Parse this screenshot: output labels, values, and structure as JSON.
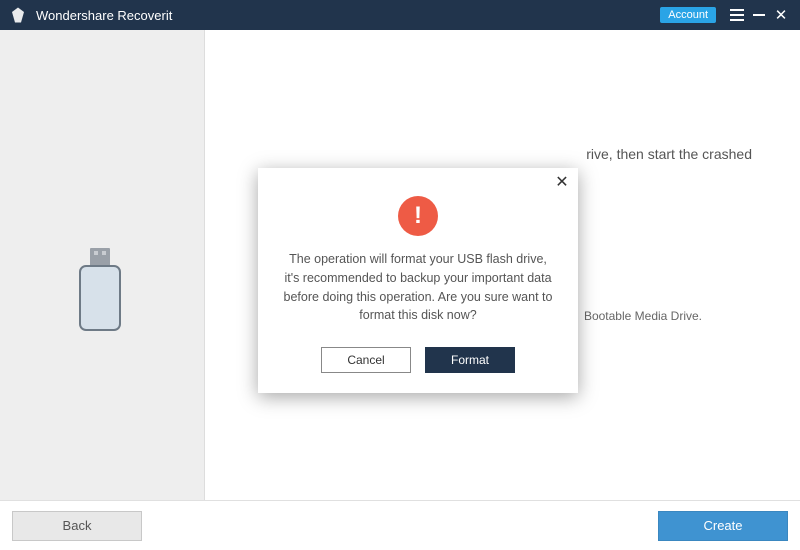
{
  "titlebar": {
    "app_title": "Wondershare Recoverit",
    "account_label": "Account"
  },
  "background": {
    "line1_fragment": "rive, then start the crashed",
    "line2_fragment": "Bootable Media Drive."
  },
  "footer": {
    "back_label": "Back",
    "create_label": "Create"
  },
  "modal": {
    "icon_glyph": "!",
    "message": "The operation will format your USB flash drive, it's recommended to backup your important data before doing this operation. Are you sure want to format this disk now?",
    "cancel_label": "Cancel",
    "format_label": "Format"
  }
}
